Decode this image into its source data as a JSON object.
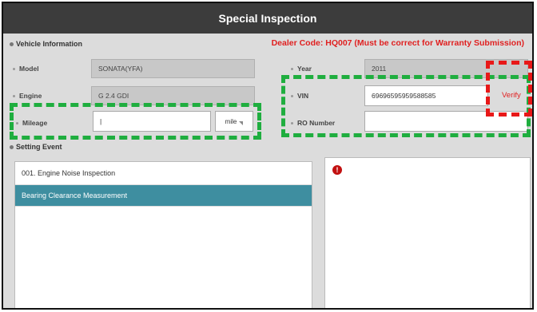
{
  "title": "Special Inspection",
  "vehicle_info_label": "Vehicle Information",
  "dealer_code": "Dealer Code: HQ007  (Must be correct for Warranty Submission)",
  "fields": {
    "model": {
      "label": "Model",
      "value": "SONATA(YFA)"
    },
    "engine": {
      "label": "Engine",
      "value": "G 2.4 GDI"
    },
    "mileage": {
      "label": "Mileage",
      "value": "|",
      "unit": "mile"
    },
    "year": {
      "label": "Year",
      "value": "2011"
    },
    "vin": {
      "label": "VIN",
      "value": "69696595959588585"
    },
    "ro_number": {
      "label": "RO Number",
      "value": ""
    }
  },
  "verify_label": "Verify",
  "setting_event_label": "Setting Event",
  "events": [
    {
      "label": "001. Engine Noise Inspection",
      "selected": false
    },
    {
      "label": "Bearing Clearance Measurement",
      "selected": true
    }
  ],
  "alert_icon_text": "!",
  "colors": {
    "title_bg": "#3c3c3c",
    "highlight_green": "#1fae3f",
    "highlight_red": "#e81818",
    "selected_row": "#3e8ea0",
    "dealer_text": "#e02020"
  }
}
